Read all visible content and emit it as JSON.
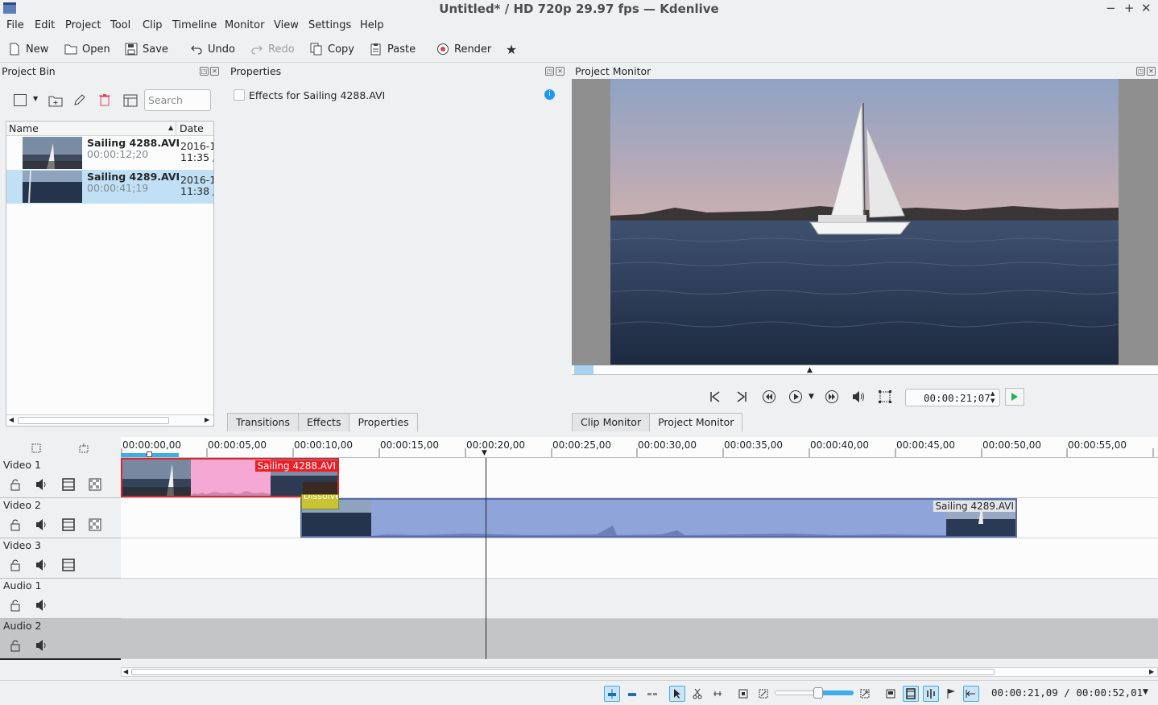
{
  "window": {
    "title": "Untitled* / HD 720p 29.97 fps — Kdenlive"
  },
  "menu": [
    "File",
    "Edit",
    "Project",
    "Tool",
    "Clip",
    "Timeline",
    "Monitor",
    "View",
    "Settings",
    "Help"
  ],
  "toolbar": {
    "new": "New",
    "open": "Open",
    "save": "Save",
    "undo": "Undo",
    "redo": "Redo",
    "copy": "Copy",
    "paste": "Paste",
    "render": "Render"
  },
  "bin": {
    "title": "Project Bin",
    "search_placeholder": "Search",
    "col_name": "Name",
    "col_date": "Date",
    "items": [
      {
        "name": "Sailing 4288.AVI",
        "duration": "00:00:12;20",
        "date": "2016-1",
        "time": "11:35 /"
      },
      {
        "name": "Sailing 4289.AVI",
        "duration": "00:00:41;19",
        "date": "2016-1",
        "time": "11:38 /"
      }
    ]
  },
  "properties": {
    "title": "Properties",
    "effects_label": "Effects for Sailing 4288.AVI",
    "tabs": [
      "Transitions",
      "Effects",
      "Properties"
    ]
  },
  "monitor": {
    "title": "Project Monitor",
    "timecode": "00:00:21;07",
    "tabs": [
      "Clip Monitor",
      "Project Monitor"
    ]
  },
  "timeline": {
    "ruler": [
      "00:00:00,00",
      "00:00:05,00",
      "00:00:10,00",
      "00:00:15,00",
      "00:00:20,00",
      "00:00:25,00",
      "00:00:30,00",
      "00:00:35,00",
      "00:00:40,00",
      "00:00:45,00",
      "00:00:50,00",
      "00:00:55,00"
    ],
    "tracks": [
      "Video 1",
      "Video 2",
      "Video 3",
      "Audio 1",
      "Audio 2"
    ],
    "clip1_label": "Sailing 4288.AVI",
    "clip2_label": "Sailing 4289.AVI",
    "transition_label": "Dissolve"
  },
  "status": {
    "timecode": "00:00:21,09 / 00:00:52,01"
  },
  "colors": {
    "accent": "#3daee9",
    "clip_video": "#8fa4d8",
    "clip_selected_border": "#e0242c",
    "clip_label_bg": "#ef1c24",
    "pink": "#f6a8d4"
  }
}
